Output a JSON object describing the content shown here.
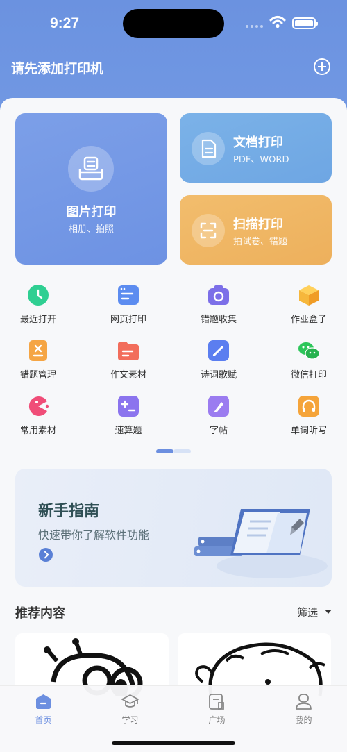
{
  "status_bar": {
    "time": "9:27"
  },
  "header": {
    "title": "请先添加打印机"
  },
  "cards": {
    "photo": {
      "title": "图片打印",
      "subtitle": "相册、拍照"
    },
    "doc": {
      "title": "文档打印",
      "subtitle": "PDF、WORD"
    },
    "scan": {
      "title": "扫描打印",
      "subtitle": "拍试卷、错题"
    }
  },
  "grid": [
    {
      "label": "最近打开",
      "icon": "clock-icon",
      "color": "#2fcf92"
    },
    {
      "label": "网页打印",
      "icon": "browser-icon",
      "color": "#5c8cf0"
    },
    {
      "label": "错题收集",
      "icon": "camera-icon",
      "color": "#7c6fe8"
    },
    {
      "label": "作业盒子",
      "icon": "box-icon",
      "color": "#f6b73c"
    },
    {
      "label": "错题管理",
      "icon": "error-note-icon",
      "color": "#f5a544"
    },
    {
      "label": "作文素材",
      "icon": "folder-icon",
      "color": "#f26d5b"
    },
    {
      "label": "诗词歌赋",
      "icon": "pen-icon",
      "color": "#5b7ef0"
    },
    {
      "label": "微信打印",
      "icon": "wechat-icon",
      "color": "#2dc65a"
    },
    {
      "label": "常用素材",
      "icon": "pacman-icon",
      "color": "#f04d78"
    },
    {
      "label": "速算题",
      "icon": "calculator-icon",
      "color": "#8b74ee"
    },
    {
      "label": "字帖",
      "icon": "brush-icon",
      "color": "#9b7cf0"
    },
    {
      "label": "单词听写",
      "icon": "headphones-icon",
      "color": "#f5a43a"
    }
  ],
  "banner": {
    "title": "新手指南",
    "subtitle": "快速带你了解软件功能"
  },
  "recommend": {
    "title": "推荐内容",
    "filter_label": "筛选"
  },
  "tabs": [
    {
      "label": "首页",
      "icon": "home-icon",
      "active": true
    },
    {
      "label": "学习",
      "icon": "graduation-cap-icon",
      "active": false
    },
    {
      "label": "广场",
      "icon": "plaza-icon",
      "active": false
    },
    {
      "label": "我的",
      "icon": "profile-icon",
      "active": false
    }
  ],
  "colors": {
    "accent": "#6c8fe0",
    "header_bg": "#6f95e2"
  }
}
